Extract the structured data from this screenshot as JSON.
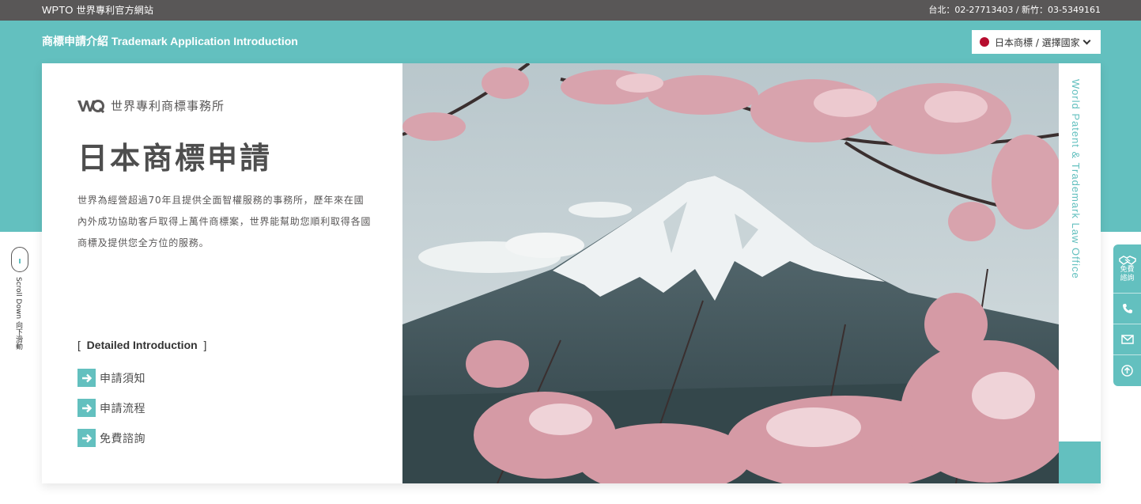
{
  "topbar": {
    "brand": "WPTO",
    "site_name": "世界專利官方網站",
    "phones": "台北：02-27713403 / 新竹：03-5349161"
  },
  "header": {
    "section_title": "商標申請介紹 Trademark Application Introduction",
    "country_select": "日本商標 / 選擇國家"
  },
  "card": {
    "logo_text": "世界專利商標事務所",
    "title": "日本商標申請",
    "description": "世界為經營超過70年且提供全面智權服務的事務所，歷年來在國內外成功協助客戶取得上萬件商標案，世界能幫助您順利取得各國商標及提供您全方位的服務。",
    "detail_heading": "Detailed Introduction",
    "links": [
      "申請須知",
      "申請流程",
      "免費諮詢"
    ],
    "vertical_text": "World Patent & Trademark Law Office"
  },
  "scroll": {
    "label_en": "Scroll Down",
    "label_zh": "向下滑動"
  },
  "floatbar": {
    "consult_label": "免費諮詢"
  },
  "colors": {
    "teal": "#63c0bf",
    "topbar": "#595757",
    "flag_red": "#b70d2f"
  },
  "icons": [
    "handshake-icon",
    "phone-icon",
    "mail-icon",
    "arrow-up-icon",
    "arrow-right-icon",
    "chevron-down-icon",
    "mouse-icon"
  ]
}
